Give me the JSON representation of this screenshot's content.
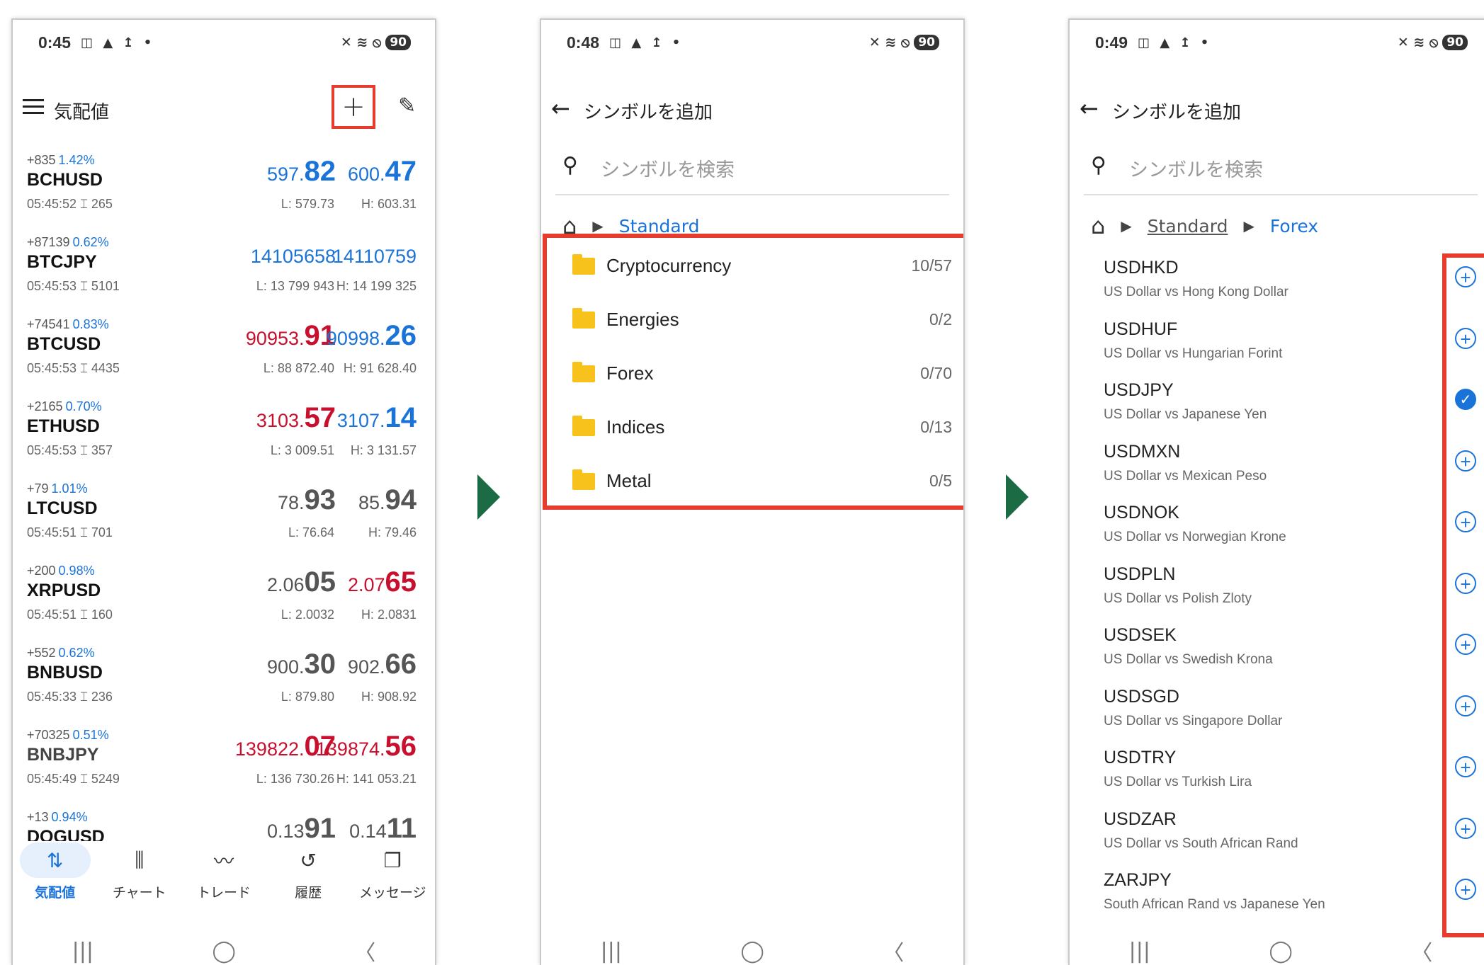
{
  "screens": [
    {
      "status": {
        "time": "0:45",
        "left_icons": "◫ ▲ ↥ •",
        "right_icons": "✕ ≋ ⦸",
        "battery": "90"
      },
      "title": "気配値",
      "quotes": [
        {
          "change": "+835",
          "pct": "1.42%",
          "symbol": "BCHUSD",
          "time": "05:45:52 ⌶ 265",
          "bid_pre": "597.",
          "bid_big": "82",
          "bid_color": "blue",
          "ask_pre": "600.",
          "ask_big": "47",
          "ask_color": "blue",
          "low": "L: 579.73",
          "high": "H: 603.31"
        },
        {
          "change": "+87139",
          "pct": "0.62%",
          "symbol": "BTCJPY",
          "time": "05:45:53 ⌶ 5101",
          "bid_pre": "14105658",
          "bid_big": "",
          "bid_color": "blue",
          "ask_pre": "14110759",
          "ask_big": "",
          "ask_color": "blue",
          "low": "L: 13 799 943",
          "high": "H: 14 199 325"
        },
        {
          "change": "+74541",
          "pct": "0.83%",
          "symbol": "BTCUSD",
          "time": "05:45:53 ⌶ 4435",
          "bid_pre": "90953.",
          "bid_big": "91",
          "bid_color": "red",
          "ask_pre": "90998.",
          "ask_big": "26",
          "ask_color": "blue",
          "low": "L: 88 872.40",
          "high": "H: 91 628.40"
        },
        {
          "change": "+2165",
          "pct": "0.70%",
          "symbol": "ETHUSD",
          "time": "05:45:53 ⌶ 357",
          "bid_pre": "3103.",
          "bid_big": "57",
          "bid_color": "red",
          "ask_pre": "3107.",
          "ask_big": "14",
          "ask_color": "blue",
          "low": "L: 3 009.51",
          "high": "H: 3 131.57"
        },
        {
          "change": "+79",
          "pct": "1.01%",
          "symbol": "LTCUSD",
          "time": "05:45:51 ⌶ 701",
          "bid_pre": "78.",
          "bid_big": "93",
          "bid_color": "grey",
          "ask_pre": "85.",
          "ask_big": "94",
          "ask_color": "grey",
          "low": "L: 76.64",
          "high": "H: 79.46"
        },
        {
          "change": "+200",
          "pct": "0.98%",
          "symbol": "XRPUSD",
          "time": "05:45:51 ⌶ 160",
          "bid_pre": "2.06",
          "bid_big": "05",
          "bid_color": "grey",
          "ask_pre": "2.07",
          "ask_big": "65",
          "ask_color": "red",
          "low": "L: 2.0032",
          "high": "H: 2.0831"
        },
        {
          "change": "+552",
          "pct": "0.62%",
          "symbol": "BNBUSD",
          "time": "05:45:33 ⌶ 236",
          "bid_pre": "900.",
          "bid_big": "30",
          "bid_color": "grey",
          "ask_pre": "902.",
          "ask_big": "66",
          "ask_color": "grey",
          "low": "L: 879.80",
          "high": "H: 908.92"
        },
        {
          "change": "+70325",
          "pct": "0.51%",
          "symbol": "BNBJPY",
          "time": "05:45:49 ⌶ 5249",
          "bid_pre": "139822.",
          "bid_big": "07",
          "bid_color": "red",
          "ask_pre": "139874.",
          "ask_big": "56",
          "ask_color": "red",
          "low": "L: 136 730.26",
          "high": "H: 141 053.21"
        },
        {
          "change": "+13",
          "pct": "0.94%",
          "symbol": "DOGUSD",
          "time": "",
          "bid_pre": "0.13",
          "bid_big": "91",
          "bid_color": "grey",
          "ask_pre": "0.14",
          "ask_big": "11",
          "ask_color": "grey",
          "low": "",
          "high": ""
        }
      ],
      "tabs": [
        {
          "label": "気配値",
          "icon": "⇅"
        },
        {
          "label": "チャート",
          "icon": "⫼"
        },
        {
          "label": "トレード",
          "icon": "〰"
        },
        {
          "label": "履歴",
          "icon": "↺"
        },
        {
          "label": "メッセージ",
          "icon": "❐"
        }
      ]
    },
    {
      "status": {
        "time": "0:48",
        "left_icons": "◫ ▲ ↥ •",
        "right_icons": "✕ ≋ ⦸",
        "battery": "90"
      },
      "title": "シンボルを追加",
      "search_placeholder": "シンボルを検索",
      "breadcrumb": [
        "Standard"
      ],
      "folders": [
        {
          "name": "Cryptocurrency",
          "count": "10/57"
        },
        {
          "name": "Energies",
          "count": "0/2"
        },
        {
          "name": "Forex",
          "count": "0/70"
        },
        {
          "name": "Indices",
          "count": "0/13"
        },
        {
          "name": "Metal",
          "count": "0/5"
        }
      ]
    },
    {
      "status": {
        "time": "0:49",
        "left_icons": "◫ ▲ ↥ •",
        "right_icons": "✕ ≋ ⦸",
        "battery": "90"
      },
      "title": "シンボルを追加",
      "search_placeholder": "シンボルを検索",
      "breadcrumb": [
        "Standard",
        "Forex"
      ],
      "symbols": [
        {
          "name": "USDHKD",
          "desc": "US Dollar vs Hong Kong Dollar",
          "added": false
        },
        {
          "name": "USDHUF",
          "desc": "US Dollar vs Hungarian Forint",
          "added": false
        },
        {
          "name": "USDJPY",
          "desc": "US Dollar vs Japanese Yen",
          "added": true
        },
        {
          "name": "USDMXN",
          "desc": "US Dollar vs Mexican Peso",
          "added": false
        },
        {
          "name": "USDNOK",
          "desc": "US Dollar vs Norwegian Krone",
          "added": false
        },
        {
          "name": "USDPLN",
          "desc": "US Dollar vs Polish Zloty",
          "added": false
        },
        {
          "name": "USDSEK",
          "desc": "US Dollar vs Swedish Krona",
          "added": false
        },
        {
          "name": "USDSGD",
          "desc": "US Dollar vs Singapore Dollar",
          "added": false
        },
        {
          "name": "USDTRY",
          "desc": "US Dollar vs Turkish Lira",
          "added": false
        },
        {
          "name": "USDZAR",
          "desc": "US Dollar vs South African Rand",
          "added": false
        },
        {
          "name": "ZARJPY",
          "desc": "South African Rand vs Japanese Yen",
          "added": false
        }
      ]
    }
  ],
  "nav": {
    "recents": "|||",
    "home": "◯",
    "back": "〈"
  },
  "colors": {
    "highlight": "#e63c2e",
    "link": "#1a73d9",
    "arrow": "#1b6b45",
    "folder": "#f7c21b",
    "down_price": "#c8102e"
  }
}
